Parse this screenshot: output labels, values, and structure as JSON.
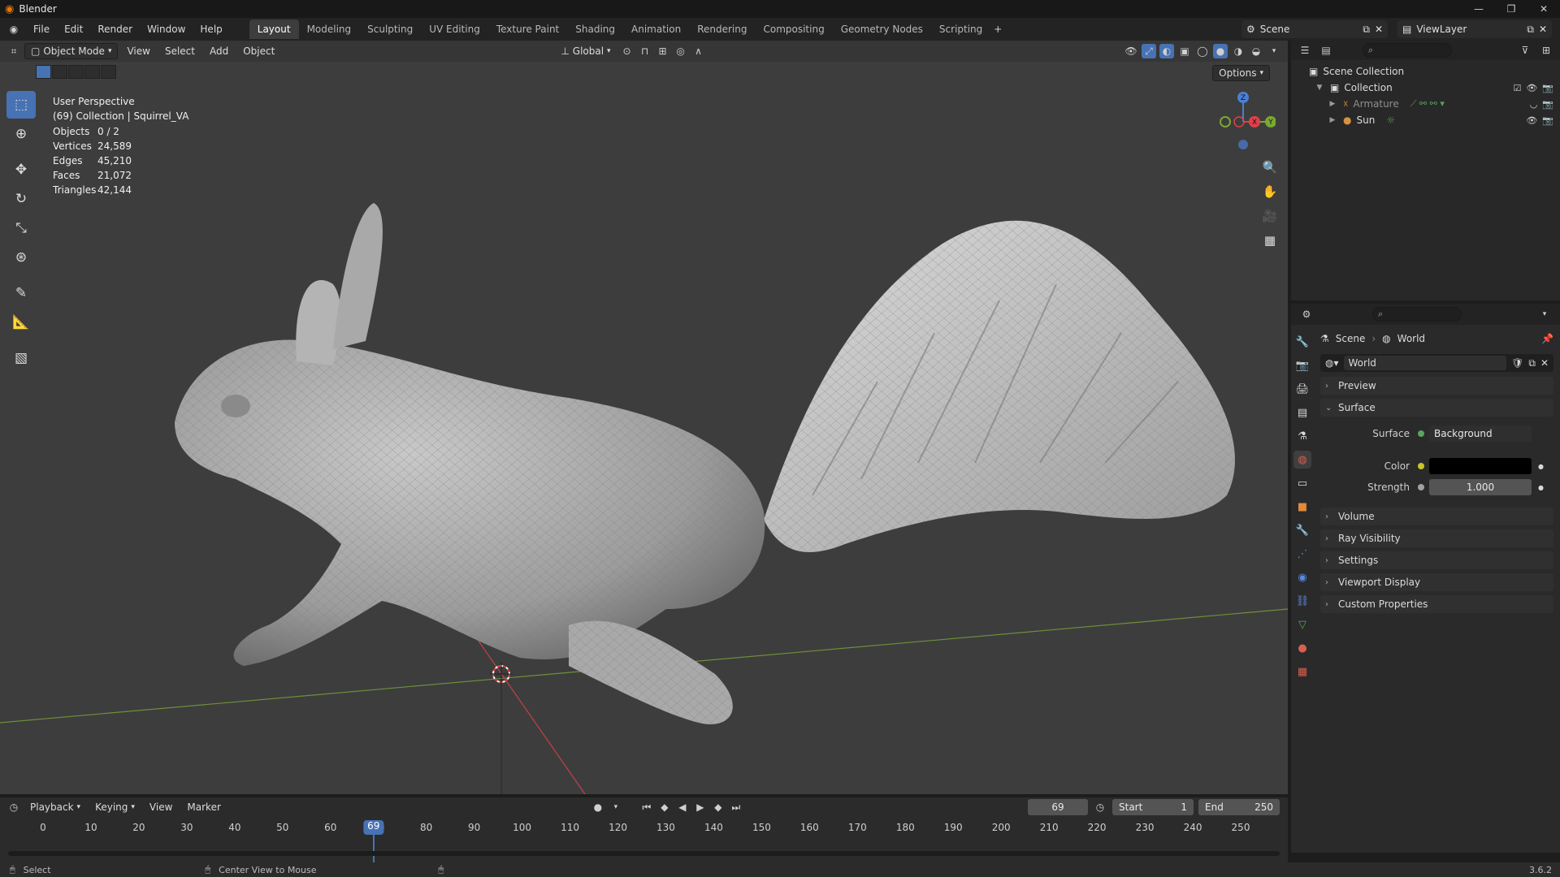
{
  "window": {
    "title": "Blender",
    "controls": [
      "—",
      "❐",
      "✕"
    ]
  },
  "menus": [
    "File",
    "Edit",
    "Render",
    "Window",
    "Help"
  ],
  "workspaces": [
    {
      "label": "Layout",
      "active": true
    },
    {
      "label": "Modeling"
    },
    {
      "label": "Sculpting"
    },
    {
      "label": "UV Editing"
    },
    {
      "label": "Texture Paint"
    },
    {
      "label": "Shading"
    },
    {
      "label": "Animation"
    },
    {
      "label": "Rendering"
    },
    {
      "label": "Compositing"
    },
    {
      "label": "Geometry Nodes"
    },
    {
      "label": "Scripting"
    }
  ],
  "scene": {
    "name": "Scene"
  },
  "view_layer": {
    "name": "ViewLayer"
  },
  "viewport_header": {
    "mode": "Object Mode",
    "menus": [
      "View",
      "Select",
      "Add",
      "Object"
    ],
    "transform_orientation": "Global",
    "options_label": "Options"
  },
  "viewport_overlay": {
    "view_name": "User Perspective",
    "collection_info": "(69) Collection | Squirrel_VA"
  },
  "stats": [
    {
      "label": "Objects",
      "value": "0 / 2"
    },
    {
      "label": "Vertices",
      "value": "24,589"
    },
    {
      "label": "Edges",
      "value": "45,210"
    },
    {
      "label": "Faces",
      "value": "21,072"
    },
    {
      "label": "Triangles",
      "value": "42,144"
    }
  ],
  "gizmo": {
    "z": "Z",
    "x": "X",
    "y": "Y"
  },
  "outliner": {
    "search_placeholder": "",
    "scene_collection": "Scene Collection",
    "collection": "Collection",
    "items": [
      {
        "name": "Armature"
      },
      {
        "name": "Sun"
      }
    ]
  },
  "properties": {
    "breadcrumb": [
      "Scene",
      "World"
    ],
    "world_name": "World",
    "panels": {
      "preview": "Preview",
      "surface": "Surface",
      "volume": "Volume",
      "ray_visibility": "Ray Visibility",
      "settings": "Settings",
      "viewport_display": "Viewport Display",
      "custom_properties": "Custom Properties"
    },
    "surface_label": "Surface",
    "surface_value": "Background",
    "color_label": "Color",
    "color_value": "#000000",
    "strength_label": "Strength",
    "strength_value": "1.000"
  },
  "timeline": {
    "menus": [
      "Playback",
      "Keying",
      "View",
      "Marker"
    ],
    "current_frame": "69",
    "start_label": "Start",
    "start": "1",
    "end_label": "End",
    "end": "250",
    "ticks": [
      "0",
      "10",
      "20",
      "30",
      "40",
      "50",
      "60",
      "70",
      "80",
      "90",
      "100",
      "110",
      "120",
      "130",
      "140",
      "150",
      "160",
      "170",
      "180",
      "190",
      "200",
      "210",
      "220",
      "230",
      "240",
      "250"
    ]
  },
  "statusbar": {
    "left_action": "Select",
    "middle_action": "Center View to Mouse",
    "version": "3.6.2"
  },
  "colors": {
    "accent": "#4772b3",
    "viewport_bg": "#3d3d3d",
    "axis_x": "#e0404a",
    "axis_y": "#7aa832",
    "axis_z": "#4a7fd6"
  }
}
